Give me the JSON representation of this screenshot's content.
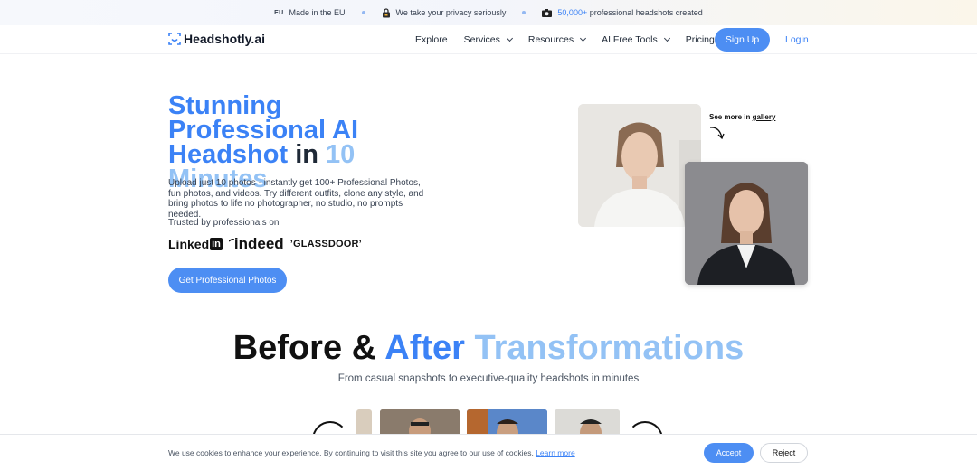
{
  "topbar": {
    "eu_badge": "EU",
    "made_in": "Made in the EU",
    "privacy": "We take your privacy seriously",
    "count": "50,000+",
    "count_suffix": "professional headshots created"
  },
  "nav": {
    "logo": "Headshotly.ai",
    "links": [
      "Explore",
      "Services",
      "Resources",
      "AI Free Tools",
      "Pricing"
    ],
    "signup": "Sign Up",
    "login": "Login"
  },
  "hero": {
    "title_part1": "Stunning Professional AI Headshot",
    "title_part2": "in",
    "title_part3": "10 Minutes",
    "description": "Upload just 10 photos - instantly get 100+ Professional Photos, fun photos, and videos. Try different outfits, clone any style, and bring photos to life no photographer, no studio, no prompts needed.",
    "trusted": "Trusted by professionals on",
    "brands": {
      "linkedin_a": "Linked",
      "linkedin_b": "in",
      "indeed": "indeed",
      "glassdoor": "GLASSDOOR"
    },
    "cta": "Get Professional Photos",
    "see_more": "See more in",
    "gallery": "gallery"
  },
  "transform": {
    "title_a": "Before &",
    "title_b": "After",
    "title_c": "Transformations",
    "subtitle": "From casual snapshots to executive-quality headshots in minutes"
  },
  "cookie": {
    "text": "We use cookies to enhance your experience. By continuing to visit this site you agree to our use of cookies.",
    "learn_more": "Learn more",
    "accept": "Accept",
    "reject": "Reject"
  },
  "colors": {
    "accent": "#4d8ef3",
    "title_blue": "#3b82f6",
    "title_light": "#93c2f5"
  }
}
